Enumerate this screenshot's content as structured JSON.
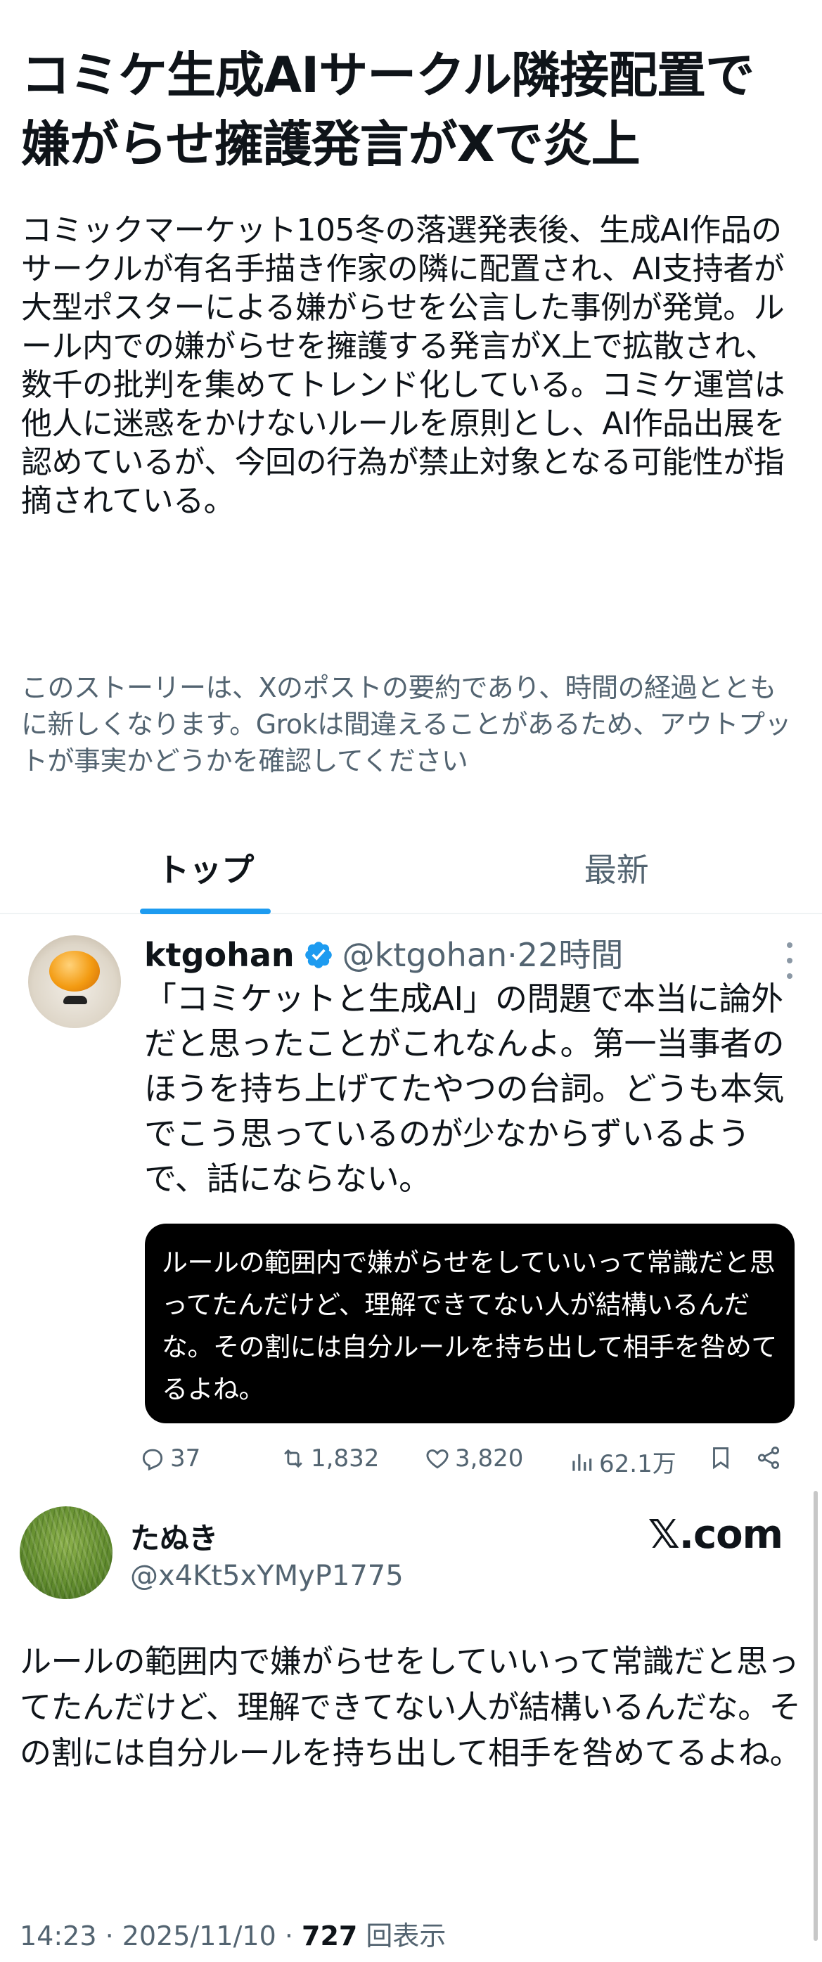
{
  "story": {
    "title": "コミケ生成AIサークル隣接配置で嫌がらせ擁護発言がXで炎上",
    "summary": "コミックマーケット105冬の落選発表後、生成AI作品のサークルが有名手描き作家の隣に配置され、AI支持者が大型ポスターによる嫌がらせを公言した事例が発覚。ルール内での嫌がらせを擁護する発言がX上で拡散され、数千の批判を集めてトレンド化している。コミケ運営は他人に迷惑をかけないルールを原則とし、AI作品出展を認めているが、今回の行為が禁止対象となる可能性が指摘されている。",
    "disclaimer": "このストーリーは、Xのポストの要約であり、時間の経過とともに新しくなります。Grokは間違えることがあるため、アウトプットが事実かどうかを確認してください"
  },
  "tabs": [
    {
      "label": "トップ",
      "active": true
    },
    {
      "label": "最新",
      "active": false
    }
  ],
  "post": {
    "author_name": "ktgohan",
    "handle": "@ktgohan",
    "time": "22時間",
    "separator": " · ",
    "text": "「コミケットと生成AI」の問題で本当に論外だと思ったことがこれなんよ。第一当事者のほうを持ち上げてたやつの台詞。どうも本気でこう思っているのが少なからずいるようで、話にならない。",
    "quote_image_text": "ルールの範囲内で嫌がらせをしていいって常識だと思ってたんだけど、理解できてない人が結構いるんだな。その割には自分ルールを持ち出して相手を咎めてるよね。",
    "stats": {
      "replies": "37",
      "reposts": "1,832",
      "likes": "3,820",
      "views": "62.1万"
    },
    "verified_color": "#1d9bf0"
  },
  "embed": {
    "name": "たぬき",
    "handle": "@x4Kt5xYMyP1775",
    "brand": "𝕏.com",
    "text": "ルールの範囲内で嫌がらせをしていいって常識だと思ってたんだけど、理解できてない人が結構いるんだな。その割には自分ルールを持ち出して相手を咎めてるよね。",
    "datetime": "14:23 · 2025/11/10 · ",
    "views_count": "727",
    "views_label": " 回表示"
  },
  "colors": {
    "accent": "#1d9bf0",
    "muted": "#536471",
    "text": "#0f1419"
  }
}
